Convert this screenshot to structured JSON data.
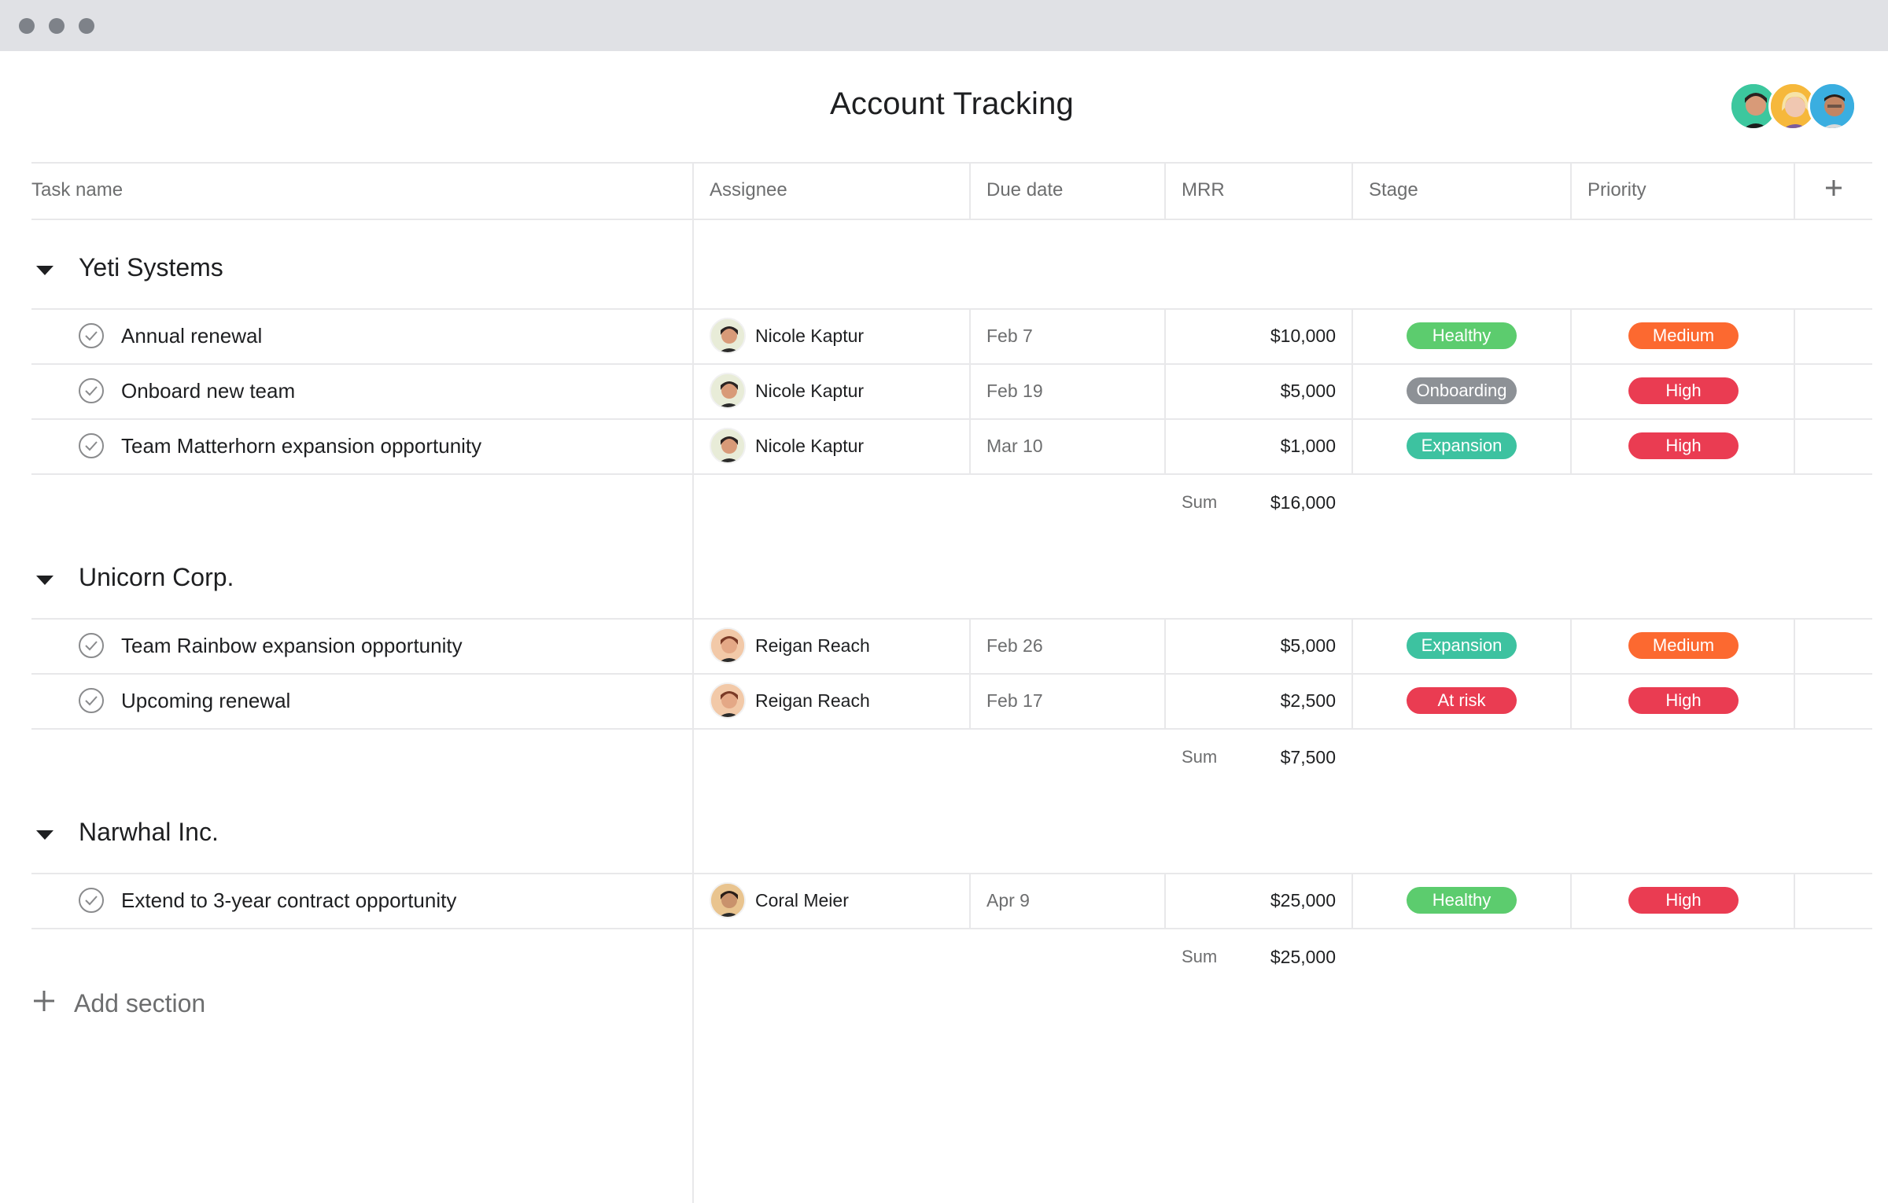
{
  "page": {
    "title": "Account Tracking"
  },
  "columns": {
    "task_name": "Task name",
    "assignee": "Assignee",
    "due_date": "Due date",
    "mrr": "MRR",
    "stage": "Stage",
    "priority": "Priority"
  },
  "sum_label": "Sum",
  "add_section_label": "Add section",
  "sections": [
    {
      "title": "Yeti Systems",
      "sum": "$16,000",
      "tasks": [
        {
          "name": "Annual renewal",
          "assignee": "Nicole Kaptur",
          "due": "Feb 7",
          "mrr": "$10,000",
          "stage": "Healthy",
          "priority": "Medium"
        },
        {
          "name": "Onboard new team",
          "assignee": "Nicole Kaptur",
          "due": "Feb 19",
          "mrr": "$5,000",
          "stage": "Onboarding",
          "priority": "High"
        },
        {
          "name": "Team Matterhorn expansion opportunity",
          "assignee": "Nicole Kaptur",
          "due": "Mar 10",
          "mrr": "$1,000",
          "stage": "Expansion",
          "priority": "High"
        }
      ]
    },
    {
      "title": "Unicorn Corp.",
      "sum": "$7,500",
      "tasks": [
        {
          "name": "Team Rainbow expansion opportunity",
          "assignee": "Reigan Reach",
          "due": "Feb 26",
          "mrr": "$5,000",
          "stage": "Expansion",
          "priority": "Medium"
        },
        {
          "name": "Upcoming renewal",
          "assignee": "Reigan Reach",
          "due": "Feb 17",
          "mrr": "$2,500",
          "stage": "At risk",
          "priority": "High"
        }
      ]
    },
    {
      "title": "Narwhal Inc.",
      "sum": "$25,000",
      "tasks": [
        {
          "name": "Extend to 3-year contract opportunity",
          "assignee": "Coral Meier",
          "due": "Apr 9",
          "mrr": "$25,000",
          "stage": "Healthy",
          "priority": "High"
        }
      ]
    }
  ],
  "colors": {
    "Healthy": "#5ccc6e",
    "Onboarding": "#8d9196",
    "Expansion": "#3dc2a0",
    "At risk": "#ea3c52",
    "Medium": "#fc6930",
    "High": "#ea3c52"
  }
}
